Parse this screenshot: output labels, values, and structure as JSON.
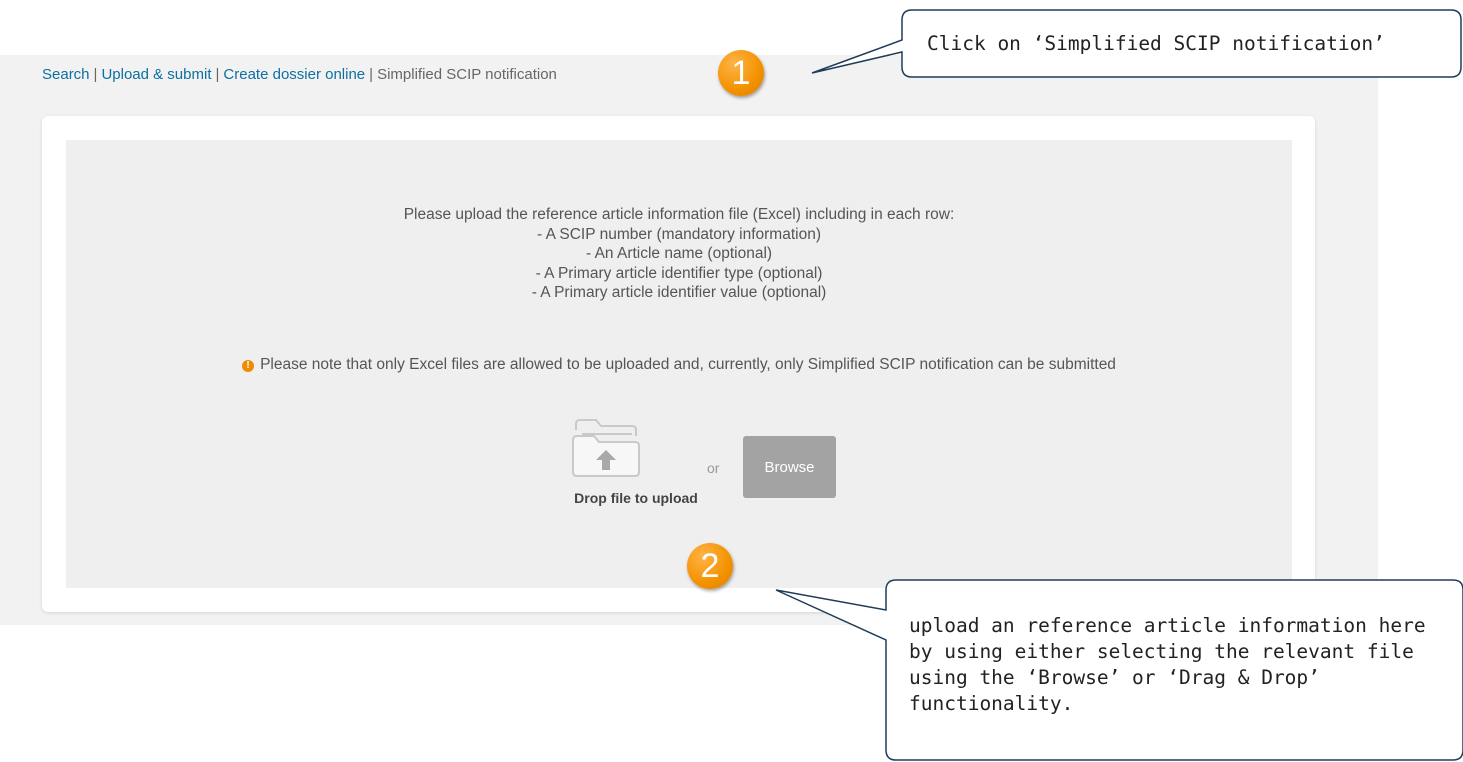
{
  "breadcrumb": {
    "items": [
      {
        "label": "Search"
      },
      {
        "label": "Upload & submit"
      },
      {
        "label": "Create dossier online"
      },
      {
        "label": "Simplified SCIP notification"
      }
    ],
    "separator": "|"
  },
  "instructions": {
    "intro": "Please upload the reference article information file (Excel) including in each row:",
    "items": [
      "- A SCIP number (mandatory information)",
      "- An Article name (optional)",
      "- A Primary article identifier type (optional)",
      "- A Primary article identifier value (optional)"
    ]
  },
  "notice": {
    "icon": "exclamation-circle-icon",
    "icon_glyph": "!",
    "text": "Please note that only Excel files are allowed to be uploaded and, currently, only Simplified SCIP notification can be submitted"
  },
  "upload": {
    "icon": "folder-upload-icon",
    "drop_label": "Drop file to upload",
    "or_label": "or",
    "browse_label": "Browse"
  },
  "annotations": {
    "step1": {
      "number": "1",
      "text": "Click on ‘Simplified SCIP notification’"
    },
    "step2": {
      "number": "2",
      "text": "upload an reference article information here by using either selecting the relevant file using the ‘Browse’ or ‘Drag & Drop’ functionality."
    }
  },
  "colors": {
    "link": "#0e6fa1",
    "marker": "#f39200",
    "browse_button": "#a3a3a3",
    "callout_border": "#1f3d5a"
  }
}
